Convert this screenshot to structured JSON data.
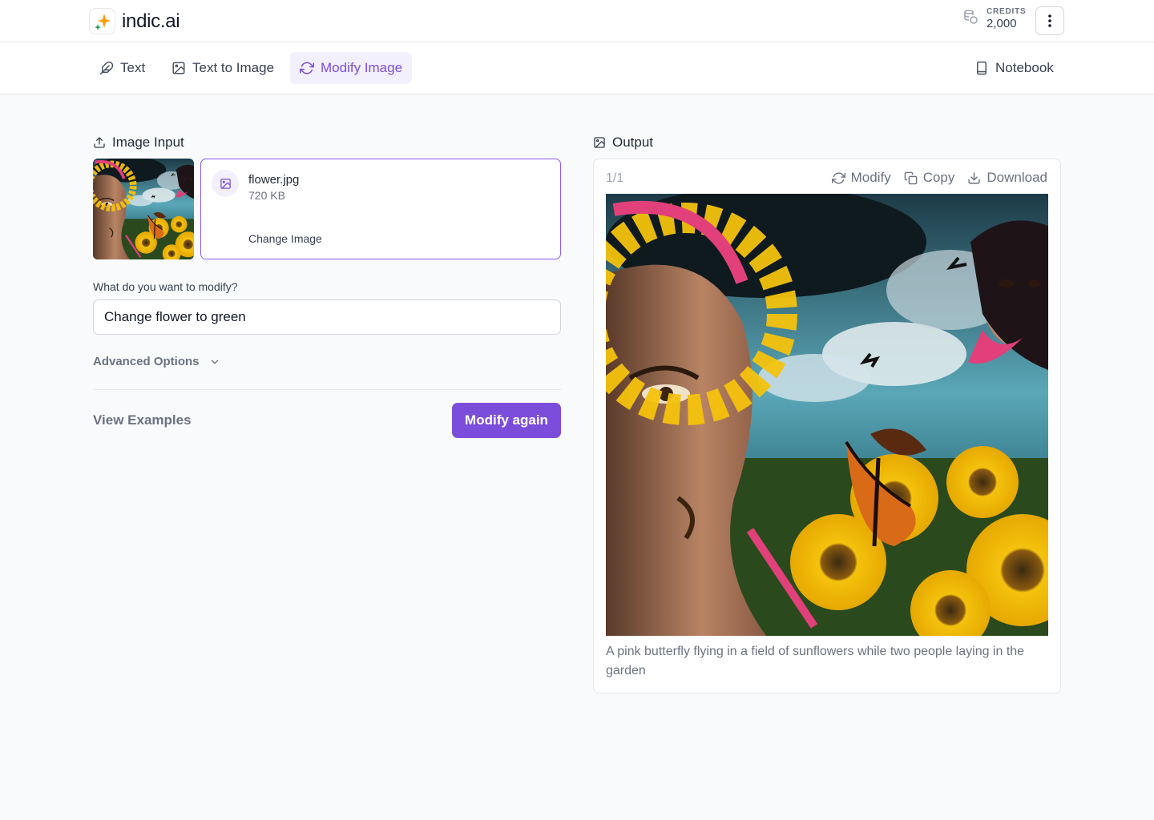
{
  "brand": {
    "name": "indic.ai",
    "accent": "#7c4ddb"
  },
  "credits": {
    "label": "CREDITS",
    "value": "2,000"
  },
  "tabs": [
    {
      "label": "Text",
      "icon": "feather-icon"
    },
    {
      "label": "Text to Image",
      "icon": "image-icon"
    },
    {
      "label": "Modify Image",
      "icon": "refresh-icon",
      "active": true
    }
  ],
  "notebook": {
    "label": "Notebook"
  },
  "input_panel": {
    "title": "Image Input",
    "file": {
      "name": "flower.jpg",
      "size": "720 KB",
      "change_label": "Change Image"
    },
    "prompt_label": "What do you want to modify?",
    "prompt_value": "Change flower to green",
    "advanced_label": "Advanced Options",
    "view_examples_label": "View Examples",
    "submit_label": "Modify again"
  },
  "output_panel": {
    "title": "Output",
    "pager": "1/1",
    "actions": {
      "modify": "Modify",
      "copy": "Copy",
      "download": "Download"
    },
    "caption": "A pink butterfly flying in a field of sunflowers while two people laying in the garden"
  }
}
